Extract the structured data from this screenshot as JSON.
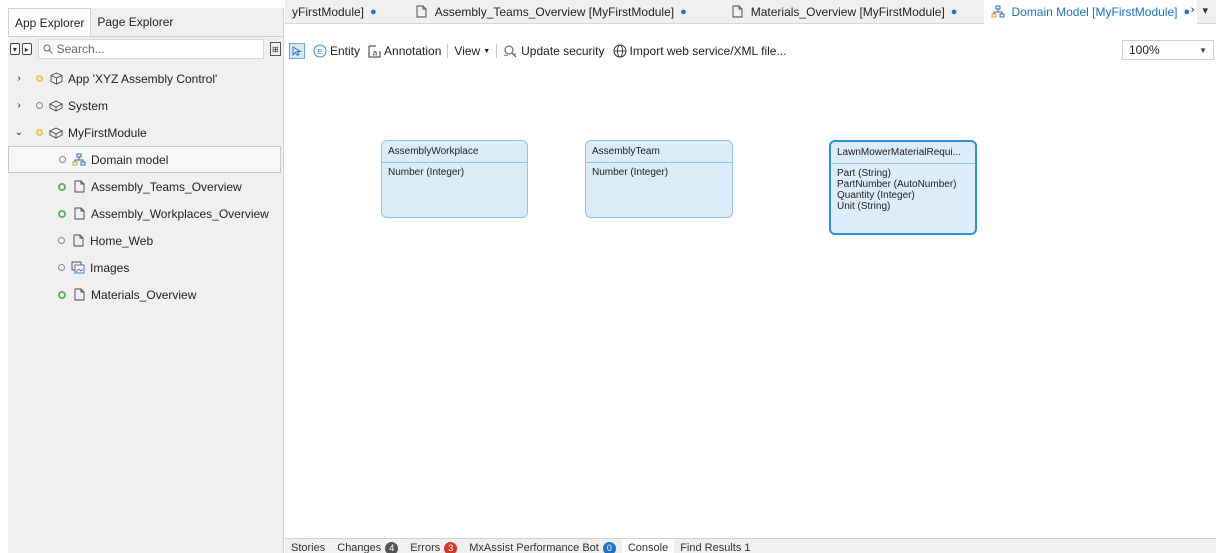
{
  "left_panel": {
    "tabs": [
      "App Explorer",
      "Page Explorer"
    ],
    "search_placeholder": "Search...",
    "tree": [
      {
        "label": "App 'XYZ Assembly Control'",
        "expanded": false,
        "status": "yellow",
        "icon": "app-icon"
      },
      {
        "label": "System",
        "expanded": false,
        "status": "hollow",
        "icon": "module-icon"
      },
      {
        "label": "MyFirstModule",
        "expanded": true,
        "status": "yellow",
        "icon": "module-icon"
      },
      {
        "label": "Domain model",
        "status": "hollow",
        "icon": "domain-model-icon",
        "selected": true
      },
      {
        "label": "Assembly_Teams_Overview",
        "status": "green",
        "icon": "page-icon"
      },
      {
        "label": "Assembly_Workplaces_Overview",
        "status": "green",
        "icon": "page-icon"
      },
      {
        "label": "Home_Web",
        "status": "hollow",
        "icon": "page-icon"
      },
      {
        "label": "Images",
        "status": "hollow",
        "icon": "images-icon"
      },
      {
        "label": "Materials_Overview",
        "status": "green",
        "icon": "page-icon"
      }
    ]
  },
  "doc_tabs": [
    {
      "label": "yFirstModule]",
      "modified": "●",
      "icon": ""
    },
    {
      "label": "Assembly_Teams_Overview [MyFirstModule]",
      "modified": "●",
      "icon": "page-icon"
    },
    {
      "label": "Materials_Overview [MyFirstModule]",
      "modified": "●",
      "icon": "page-icon"
    },
    {
      "label": "Domain Model [MyFirstModule]",
      "modified": "●",
      "icon": "domain-model-icon",
      "active": true
    }
  ],
  "toolbar": {
    "entity_label": "Entity",
    "annotation_label": "Annotation",
    "view_label": "View",
    "update_security_label": "Update security",
    "import_label": "Import web service/XML file...",
    "zoom": "100%"
  },
  "entities": [
    {
      "name": "AssemblyWorkplace",
      "attributes": [
        "Number (Integer)"
      ],
      "selected": false
    },
    {
      "name": "AssemblyTeam",
      "attributes": [
        "Number (Integer)"
      ],
      "selected": false
    },
    {
      "name": "LawnMowerMaterialRequi...",
      "attributes": [
        "Part (String)",
        "PartNumber (AutoNumber)",
        "Quantity (Integer)",
        "Unit (String)"
      ],
      "selected": true
    }
  ],
  "bottom_tabs": [
    {
      "label": "Stories"
    },
    {
      "label": "Changes",
      "badge": "4",
      "badge_color": "#555555"
    },
    {
      "label": "Errors",
      "badge": "3",
      "badge_color": "#d9342b"
    },
    {
      "label": "MxAssist Performance Bot",
      "badge": "0",
      "badge_color": "#1a73c8"
    },
    {
      "label": "Console",
      "active": true
    },
    {
      "label": "Find Results 1"
    }
  ]
}
